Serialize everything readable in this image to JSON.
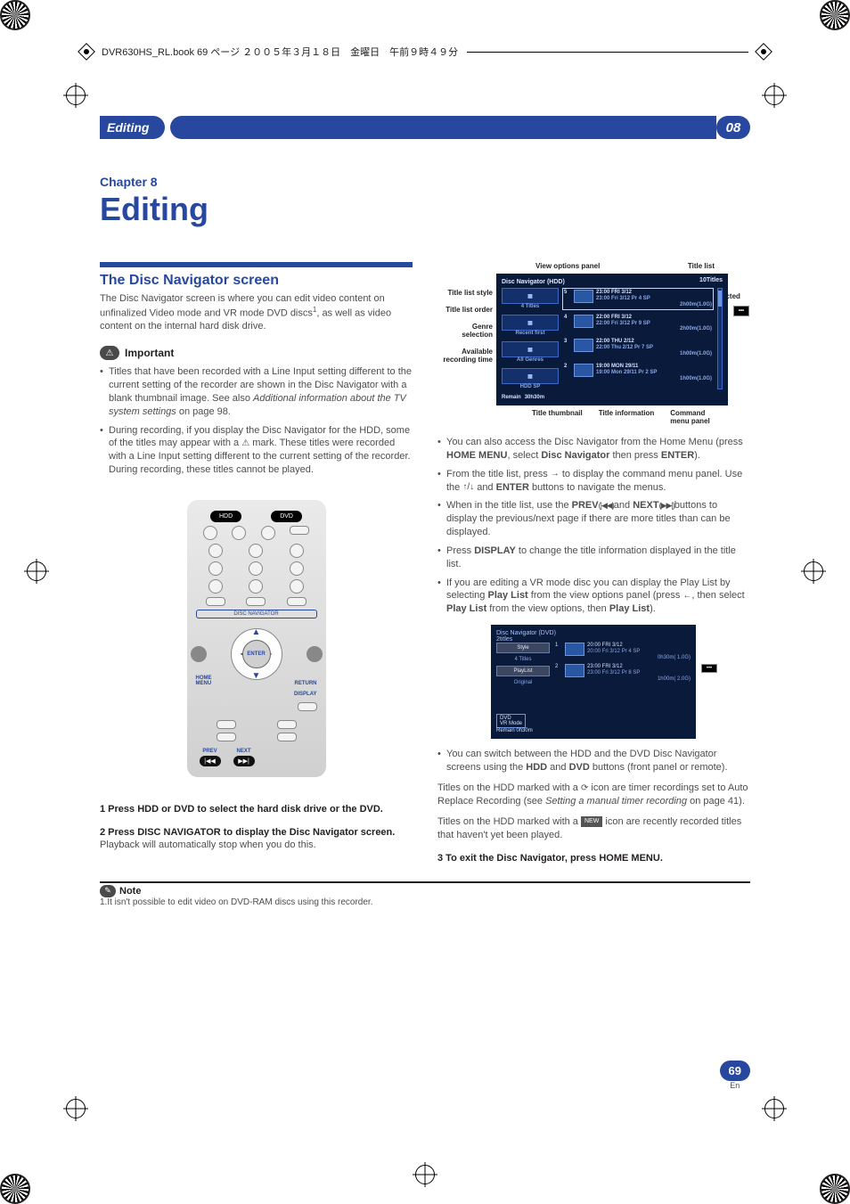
{
  "book_header": "DVR630HS_RL.book  69 ページ  ２００５年３月１８日　金曜日　午前９時４９分",
  "header_bar": {
    "title": "Editing",
    "chapter_num": "08"
  },
  "chapter": {
    "label": "Chapter 8",
    "title": "Editing"
  },
  "section1": {
    "heading": "The Disc Navigator screen",
    "para1a": "The Disc Navigator screen is where you can edit video content on unfinalized Video mode and VR mode DVD discs",
    "para1b": ", as well as video content on the internal hard disk drive.",
    "sup1": "1",
    "important_label": "Important",
    "bullet1a": "Titles that have been recorded with a Line Input setting different to the current setting of the recorder are shown in the Disc Navigator with a blank thumbnail image. See also ",
    "bullet1b": "Additional information about the TV system settings",
    "bullet1c": " on page 98.",
    "bullet2a": "During recording, if you display the Disc Navigator for the HDD, some of the titles may appear with a ",
    "bullet2b": " mark. These titles were recorded with a Line Input setting different to the current setting of the recorder. During recording, these titles cannot be played."
  },
  "remote": {
    "hdd": "HDD",
    "dvd": "DVD",
    "disc_nav": "DISC NAVIGATOR",
    "enter": "ENTER",
    "home_menu": "HOME\nMENU",
    "return": "RETURN",
    "display": "DISPLAY",
    "prev": "PREV",
    "next": "NEXT",
    "prev_sym": "|◀◀",
    "next_sym": "▶▶|"
  },
  "steps": {
    "s1": "1   Press HDD or DVD to select the hard disk drive or the DVD.",
    "s2": "2   Press DISC NAVIGATOR to display the Disc Navigator screen.",
    "s2_sub": "Playback will automatically stop when you do this."
  },
  "note": {
    "label": "Note",
    "text": "1.It isn't possible to edit video on DVD-RAM discs using this recorder."
  },
  "diagram_labels": {
    "view_options": "View options panel",
    "title_list": "Title list",
    "title_list_style": "Title list style",
    "title_list_order": "Title list order",
    "genre_selection": "Genre\nselection",
    "available_time": "Available\nrecording time",
    "selected_title": "Selected\ntitle",
    "title_thumbnail": "Title thumbnail",
    "title_information": "Title information",
    "command_panel": "Command\nmenu panel"
  },
  "nav_screenshot": {
    "window_title": "Disc Navigator (HDD)",
    "count": "10Titles",
    "left_tiles": [
      {
        "icon": "grid",
        "sub": "4 Titles"
      },
      {
        "icon": "sort",
        "sub": "Recent first"
      },
      {
        "icon": "genre",
        "sub": "All Genres"
      },
      {
        "icon": "disc",
        "sub": "HDD\nSP"
      }
    ],
    "footer_remain_label": "Remain",
    "footer_remain_value": "30h30m",
    "rows": [
      {
        "n": "5",
        "l1": "23:00  FRI  3/12",
        "l2": "23:00   Fri  3/12   Pr 4    SP",
        "l3": "2h00m(1.0G)",
        "sel": true
      },
      {
        "n": "4",
        "l1": "22:00  FRI  3/12",
        "l2": "22:00   Fri  3/12   Pr 9    SP",
        "l3": "2h00m(1.0G)",
        "sel": false
      },
      {
        "n": "3",
        "l1": "22:00  THU  2/12",
        "l2": "22:00   Thu  2/12   Pr 7   SP",
        "l3": "1h00m(1.0G)",
        "sel": false
      },
      {
        "n": "2",
        "l1": "19:00  MON  29/11",
        "l2": "19:00   Mon  29/11   Pr 2   SP",
        "l3": "1h00m(1.0G)",
        "sel": false
      }
    ]
  },
  "right_bullets": {
    "b1a": "You can also access the Disc Navigator from the Home Menu (press ",
    "b1_home": "HOME MENU",
    "b1b": ", select ",
    "b1_disc": "Disc Navigator",
    "b1c": " then press ",
    "b1_enter": "ENTER",
    "b1d": ").",
    "b2a": "From the title list, press ",
    "b2_arrow": "→",
    "b2b": " to display the command menu panel. Use the ",
    "b2_ud": "↑/↓",
    "b2c": " and ",
    "b2_enter": "ENTER",
    "b2d": " buttons to navigate the menus.",
    "b3a": "When in the title list, use the ",
    "b3_prev": "PREV",
    "b3_psym": " (|◀◀) ",
    "b3b": "and ",
    "b3_next": "NEXT",
    "b3_nsym": " (▶▶|) ",
    "b3c": "buttons to display the previous/next page if there are more titles than can be displayed.",
    "b4a": "Press ",
    "b4_disp": "DISPLAY",
    "b4b": " to change the title information displayed in the title list.",
    "b5a": "If you are editing a VR mode disc you can display the Play List by selecting ",
    "b5_pl": "Play List",
    "b5b": "  from the view options panel (press ",
    "b5_arrow": "←",
    "b5c": ", then select ",
    "b5_pl2": "Play List",
    "b5d": " from the view options, then ",
    "b5_pl3": "Play List",
    "b5e": ")."
  },
  "mini_screenshot": {
    "window_title": "Disc Navigator (DVD)",
    "count": "2titles",
    "tiles": [
      {
        "t": "Style",
        "s": "4 Titles"
      },
      {
        "t": "PlayList",
        "s": "Original"
      }
    ],
    "rows": [
      {
        "n": "1",
        "l1": "20:00  FRI  3/12",
        "l2": "20:00    Fri 3/12   Pr  4       SP",
        "l3": "0h30m( 1.0G)"
      },
      {
        "n": "2",
        "l1": "23:00  FRI  3/12",
        "l2": "23:00    Fri 3/12   Pr  8       SP",
        "l3": "1h00m( 2.0G)"
      }
    ],
    "badge": "DVD\nVR Mode",
    "remain_label": "Remain",
    "remain_value": "0h30m"
  },
  "right_bullets2": {
    "b6a": "You can switch between the HDD and the DVD Disc Navigator screens using the ",
    "b6_hdd": "HDD",
    "b6b": " and ",
    "b6_dvd": "DVD",
    "b6c": " buttons (front panel or remote)."
  },
  "right_paras": {
    "p1a": "Titles on the HDD marked with a ",
    "p1b": " icon are timer recordings set to Auto Replace Recording (see ",
    "p1_ital": "Setting a manual timer recording",
    "p1c": " on page 41).",
    "p2a": "Titles on the HDD marked with a ",
    "p2_new": "NEW",
    "p2b": " icon are recently recorded titles that haven't yet been played."
  },
  "step3": "3   To exit the Disc Navigator, press HOME MENU",
  "step3_dot": ".",
  "page": {
    "num": "69",
    "lang": "En"
  }
}
